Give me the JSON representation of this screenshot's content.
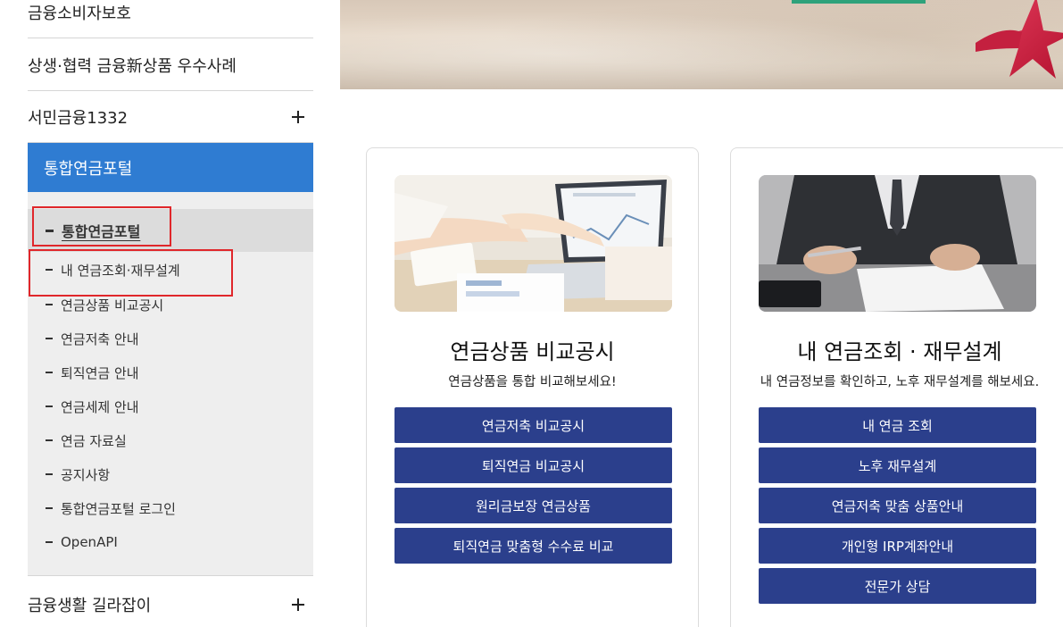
{
  "sidebar": {
    "top_items": [
      {
        "label": "금융소비자보호"
      },
      {
        "label": "상생·협력 금융新상품 우수사례"
      },
      {
        "label": "서민금융1332"
      }
    ],
    "active_section": "통합연금포털",
    "sub_items": [
      {
        "label": "통합연금포털"
      },
      {
        "label": "내 연금조회·재무설계"
      },
      {
        "label": "연금상품 비교공시"
      },
      {
        "label": "연금저축 안내"
      },
      {
        "label": "퇴직연금 안내"
      },
      {
        "label": "연금세제 안내"
      },
      {
        "label": "연금 자료실"
      },
      {
        "label": "공지사항"
      },
      {
        "label": "통합연금포털 로그인"
      },
      {
        "label": "OpenAPI"
      }
    ],
    "bottom_item": {
      "label": "금융생활 길라잡이"
    }
  },
  "cards": [
    {
      "title": "연금상품 비교공시",
      "subtitle": "연금상품을 통합 비교해보세요!",
      "buttons": [
        "연금저축 비교공시",
        "퇴직연금 비교공시",
        "원리금보장 연금상품",
        "퇴직연금 맞춤형 수수료 비교"
      ]
    },
    {
      "title": "내 연금조회 · 재무설계",
      "subtitle": "내 연금정보를 확인하고, 노후 재무설계를 해보세요.",
      "buttons": [
        "내 연금 조회",
        "노후 재무설계",
        "연금저축 맞춤 상품안내",
        "개인형 IRP계좌안내",
        "전문가 상담"
      ]
    }
  ],
  "colors": {
    "active_blue": "#2f7cd2",
    "button_navy": "#2b3f8c",
    "highlight_red": "#e0272b",
    "submenu_bg": "#eeeeee"
  },
  "icons": {
    "expand": "plus-icon",
    "bullet": "dash-icon"
  }
}
